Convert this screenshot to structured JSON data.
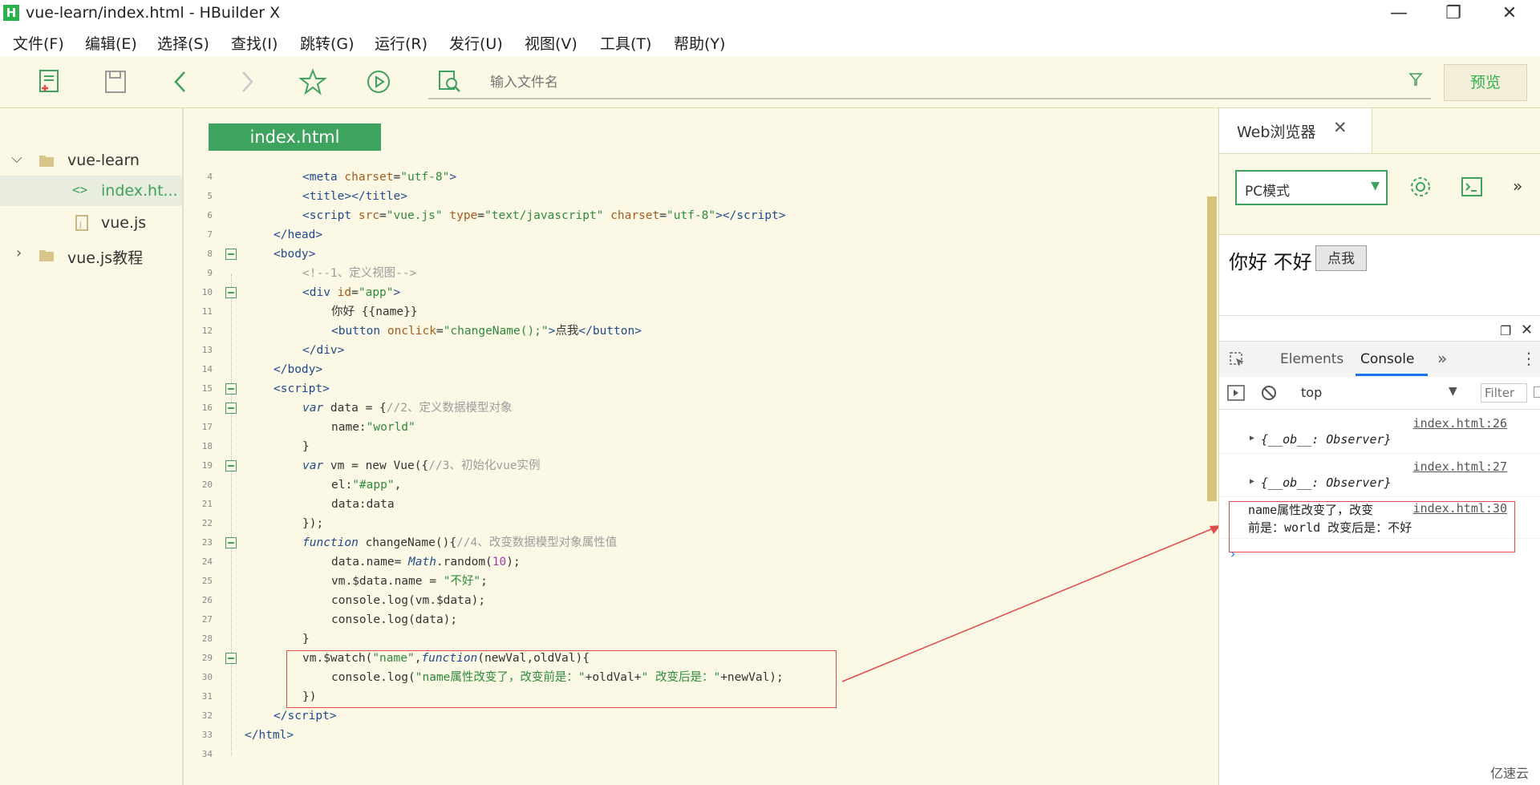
{
  "window": {
    "title": "vue-learn/index.html - HBuilder X",
    "logo": "H"
  },
  "menu": [
    "文件(F)",
    "编辑(E)",
    "选择(S)",
    "查找(I)",
    "跳转(G)",
    "运行(R)",
    "发行(U)",
    "视图(V)",
    "工具(T)",
    "帮助(Y)"
  ],
  "toolbar": {
    "search_placeholder": "输入文件名",
    "preview_label": "预览"
  },
  "sidebar": {
    "items": [
      {
        "label": "vue-learn",
        "type": "folder",
        "expanded": true
      },
      {
        "label": "index.ht...",
        "type": "html-file",
        "selected": true
      },
      {
        "label": "vue.js",
        "type": "js-file"
      },
      {
        "label": "vue.js教程",
        "type": "folder",
        "expanded": false
      }
    ]
  },
  "editor": {
    "tab": "index.html",
    "line_numbers": [
      "4",
      "5",
      "6",
      "7",
      "8",
      "9",
      "10",
      "11",
      "12",
      "13",
      "14",
      "15",
      "16",
      "17",
      "18",
      "19",
      "20",
      "21",
      "22",
      "23",
      "24",
      "25",
      "26",
      "27",
      "28",
      "29",
      "30",
      "31",
      "32",
      "33",
      "34"
    ]
  },
  "browser": {
    "tab_label": "Web浏览器",
    "mode": "PC模式",
    "page_text": "你好 不好",
    "page_button": "点我"
  },
  "devtools": {
    "tabs": [
      "Elements",
      "Console"
    ],
    "active_tab": "Console",
    "context": "top",
    "filter_placeholder": "Filter",
    "logs": [
      {
        "source": "index.html:26",
        "text": "{__ob__: Observer}"
      },
      {
        "source": "index.html:27",
        "text": "{__ob__: Observer}"
      },
      {
        "source": "index.html:30",
        "text": "name属性改变了，改变",
        "text2": "前是：world 改变后是：不好"
      }
    ]
  },
  "watermark": "亿速云",
  "colors": {
    "accent": "#3ea35e",
    "highlight_box": "#e04b4b",
    "editor_bg": "#fcf8e6"
  }
}
